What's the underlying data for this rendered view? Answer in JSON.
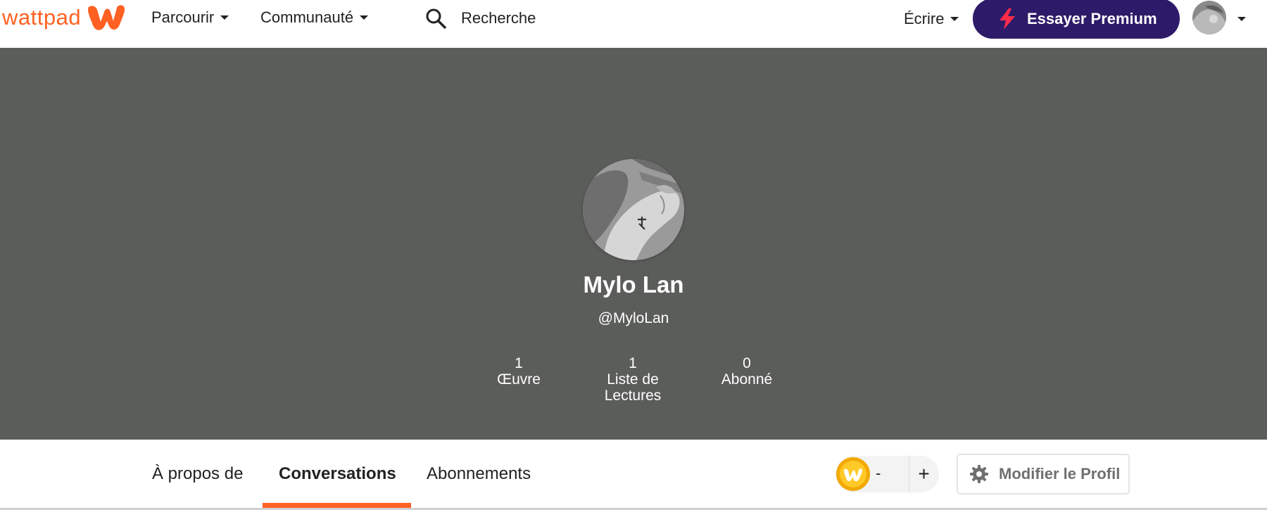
{
  "nav": {
    "logo_text": "wattpad",
    "browse_label": "Parcourir",
    "community_label": "Communauté",
    "search_label": "Recherche",
    "write_label": "Écrire",
    "premium_label": "Essayer Premium"
  },
  "colors": {
    "brand_orange": "#ff6122",
    "premium_purple": "#2d1b69",
    "banner_gray": "#5b5d5a"
  },
  "icons": {
    "logo": "wattpad-w-icon",
    "search": "search-icon",
    "premium": "lightning-bolt-icon",
    "coin": "wattpad-coin-icon",
    "settings": "gear-icon"
  },
  "profile": {
    "name": "Mylo Lan",
    "handle": "@MyloLan",
    "stats": [
      {
        "value": "1",
        "label": "Œuvre"
      },
      {
        "value": "1",
        "label": "Liste de Lectures"
      },
      {
        "value": "0",
        "label": "Abonné"
      }
    ]
  },
  "tabs": [
    {
      "label": "À propos de",
      "active": false
    },
    {
      "label": "Conversations",
      "active": true
    },
    {
      "label": "Abonnements",
      "active": false
    }
  ],
  "coins": {
    "count": "-",
    "add_label": "+"
  },
  "edit_profile_label": "Modifier le Profil"
}
